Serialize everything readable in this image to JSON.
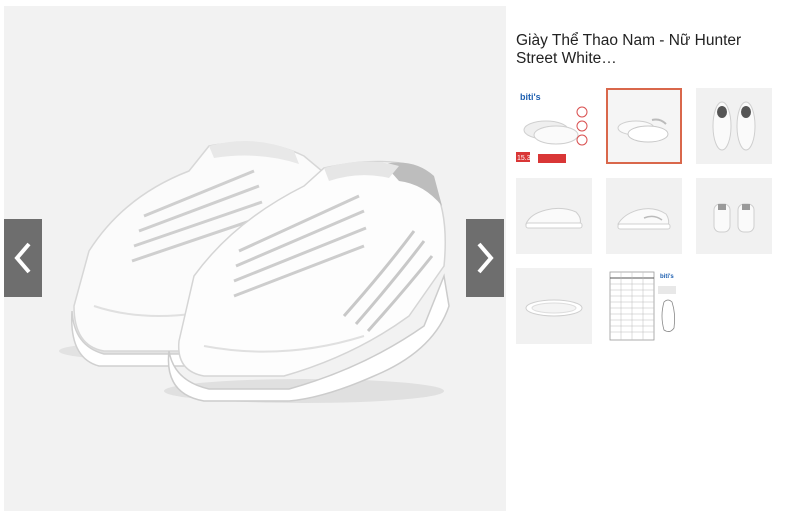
{
  "product": {
    "title": "Giày Thể Thao Nam - Nữ Hunter Street White…"
  },
  "viewer": {
    "prev_icon": "chevron-left-icon",
    "next_icon": "chevron-right-icon",
    "nav_color": "#6e6e6e"
  },
  "thumbnails": [
    {
      "name": "promo-banner",
      "selected": false,
      "brand": "biti's",
      "badge": "15.3"
    },
    {
      "name": "pair-angle",
      "selected": true
    },
    {
      "name": "pair-top",
      "selected": false
    },
    {
      "name": "side-view",
      "selected": false
    },
    {
      "name": "front-angle",
      "selected": false
    },
    {
      "name": "back-view",
      "selected": false
    },
    {
      "name": "sole-view",
      "selected": false
    },
    {
      "name": "size-chart",
      "selected": false,
      "brand": "biti's"
    }
  ],
  "accent_color": "#d9674b"
}
